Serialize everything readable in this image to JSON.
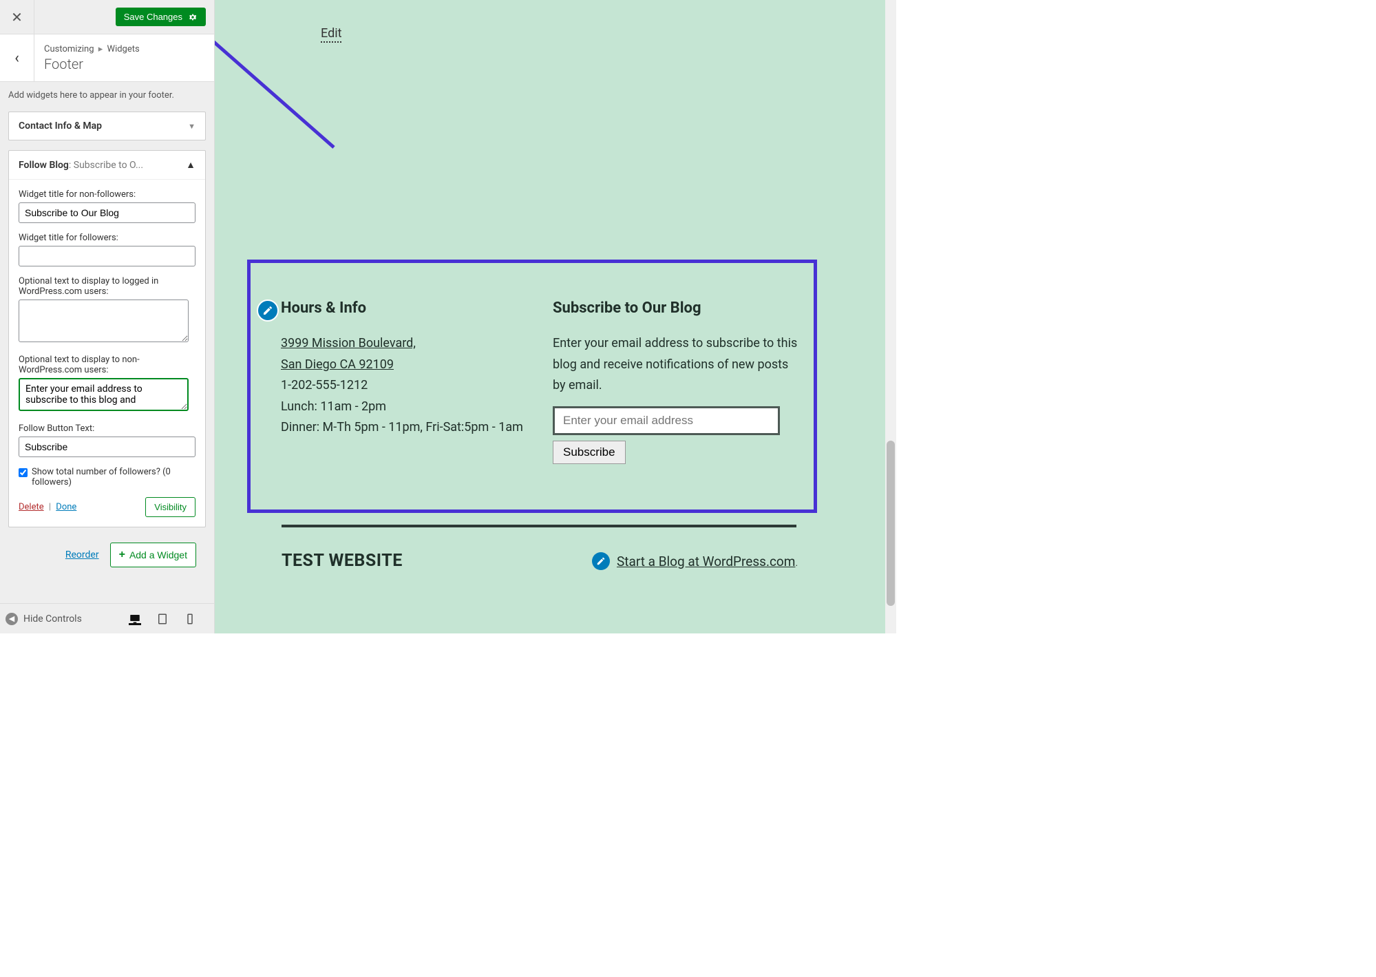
{
  "header": {
    "save_label": "Save Changes"
  },
  "breadcrumb": {
    "root": "Customizing",
    "leaf": "Widgets",
    "title": "Footer"
  },
  "help_text": "Add widgets here to appear in your footer.",
  "widgets": {
    "collapsed": {
      "title": "Contact Info & Map"
    },
    "follow_blog": {
      "title_strong": "Follow Blog",
      "title_sub": ": Subscribe to O...",
      "fields": {
        "nonfollowers_label": "Widget title for non-followers:",
        "nonfollowers_value": "Subscribe to Our Blog",
        "followers_label": "Widget title for followers:",
        "followers_value": "",
        "loggedin_label": "Optional text to display to logged in WordPress.com users:",
        "loggedin_value": "",
        "nonwp_label": "Optional text to display to non-WordPress.com users:",
        "nonwp_value": "Enter your email address to subscribe to this blog and",
        "button_text_label": "Follow Button Text:",
        "button_text_value": "Subscribe",
        "show_total_label": "Show total number of followers? (0 followers)"
      },
      "actions": {
        "delete": "Delete",
        "done": "Done",
        "visibility": "Visibility"
      }
    }
  },
  "sidebar_footer": {
    "reorder": "Reorder",
    "add_widget": "Add a Widget"
  },
  "sidebar_bottom": {
    "hide_controls": "Hide Controls"
  },
  "preview": {
    "edit_shortcut": "Edit",
    "hours": {
      "heading": "Hours & Info",
      "address_line1": "3999 Mission Boulevard,",
      "address_line2": "San Diego CA 92109",
      "phone": "1-202-555-1212",
      "lunch": "Lunch: 11am - 2pm",
      "dinner": "Dinner: M-Th 5pm - 11pm, Fri-Sat:5pm - 1am"
    },
    "subscribe": {
      "heading": "Subscribe to Our Blog",
      "desc": "Enter your email address to subscribe to this blog and receive notifications of new posts by email.",
      "placeholder": "Enter your email address",
      "button": "Subscribe"
    },
    "site_title": "TEST WEBSITE",
    "start_blog": "Start a Blog at WordPress.com",
    "start_blog_period": "."
  }
}
